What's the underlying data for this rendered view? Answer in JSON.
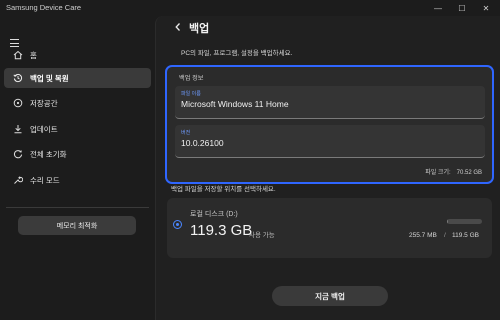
{
  "app": {
    "title": "Samsung Device Care"
  },
  "window": {
    "minimize": "—",
    "maximize": "☐",
    "close": "✕"
  },
  "sidebar": {
    "items": [
      {
        "label": "홈",
        "icon": "home-icon"
      },
      {
        "label": "백업 및 복원",
        "icon": "backup-restore-icon",
        "active": true
      },
      {
        "label": "저장공간",
        "icon": "storage-icon"
      },
      {
        "label": "업데이트",
        "icon": "download-icon"
      },
      {
        "label": "전체 초기화",
        "icon": "reset-icon"
      },
      {
        "label": "수리 모드",
        "icon": "wrench-icon"
      }
    ],
    "memory_button": "메모리 최적화"
  },
  "main": {
    "title": "백업",
    "description": "PC의 파일, 프로그램, 설정을 백업하세요.",
    "info_card": {
      "title": "백업 정보",
      "device_label": "파일 이름",
      "device_value": "Microsoft Windows 11 Home",
      "version_label": "버전",
      "version_value": "10.0.26100",
      "filesize_label": "파일 크기:",
      "filesize_value": "70.52 GB"
    },
    "location_description": "백업 파일을 저장할 위치를 선택하세요.",
    "drive": {
      "name": "로컬 디스크 (D:)",
      "available": "119.3 GB",
      "available_suffix": "사용 가능",
      "used": "255.7 MB",
      "separator": "/",
      "total": "119.5 GB",
      "usage_fraction": 0.002
    },
    "backup_button": "지금 백업"
  },
  "colors": {
    "accent": "#2f66ff",
    "radio": "#4a86ff",
    "field_label": "#6f9cff"
  }
}
